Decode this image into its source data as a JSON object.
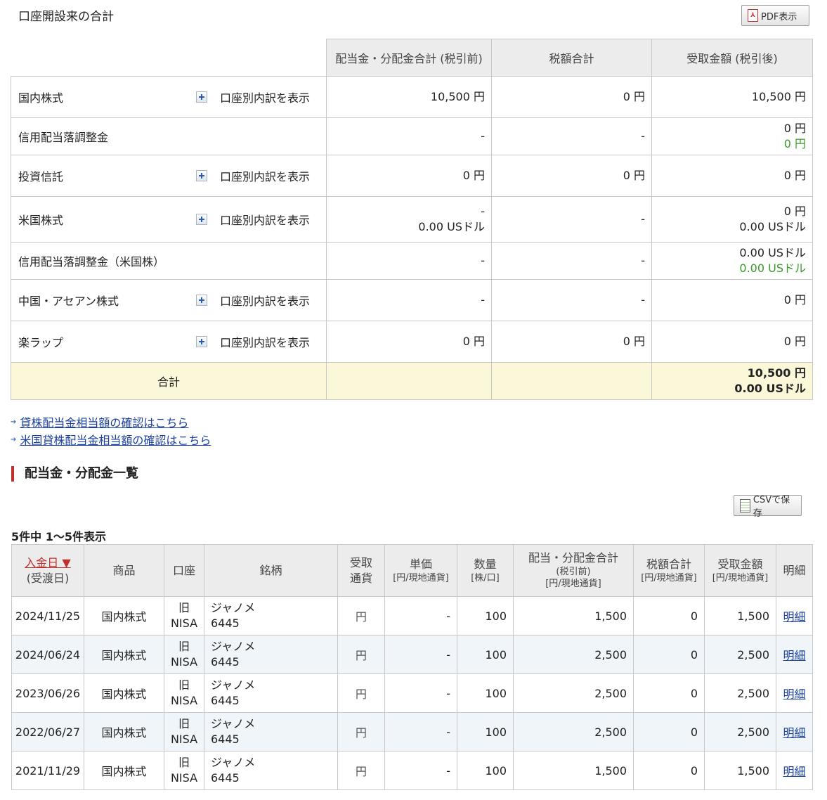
{
  "summary": {
    "title": "口座開設来の合計",
    "pdf_label": "PDF表示",
    "headers": [
      "配当金・分配金合計 (税引前)",
      "税額合計",
      "受取金額 (税引後)"
    ],
    "expand_label": "口座別内訳を表示",
    "rows": [
      {
        "label": "国内株式",
        "expandable": true,
        "pretax": [
          "10,500 円"
        ],
        "tax": [
          "0 円"
        ],
        "received": [
          "10,500 円"
        ],
        "received_green": []
      },
      {
        "label": "信用配当落調整金",
        "expandable": false,
        "pretax": [
          "-"
        ],
        "tax": [
          "-"
        ],
        "received": [
          "0 円"
        ],
        "received_green": [
          "0 円"
        ]
      },
      {
        "label": "投資信託",
        "expandable": true,
        "pretax": [
          "0 円"
        ],
        "tax": [
          "0 円"
        ],
        "received": [
          "0 円"
        ],
        "received_green": []
      },
      {
        "label": "米国株式",
        "expandable": true,
        "pretax": [
          "-",
          "0.00 USドル"
        ],
        "tax": [
          "-"
        ],
        "received": [
          "0 円",
          "0.00 USドル"
        ],
        "received_green": []
      },
      {
        "label": "信用配当落調整金（米国株）",
        "expandable": false,
        "pretax": [
          "-"
        ],
        "tax": [
          "-"
        ],
        "received": [
          "0.00 USドル"
        ],
        "received_green": [
          "0.00 USドル"
        ]
      },
      {
        "label": "中国・アセアン株式",
        "expandable": true,
        "pretax": [
          "-"
        ],
        "tax": [
          "-"
        ],
        "received": [
          "0 円"
        ],
        "received_green": []
      },
      {
        "label": "楽ラップ",
        "expandable": true,
        "pretax": [
          "0 円"
        ],
        "tax": [
          "0 円"
        ],
        "received": [
          "0 円"
        ],
        "received_green": []
      }
    ],
    "total": {
      "label": "合計",
      "received": [
        "10,500 円",
        "0.00 USドル"
      ]
    }
  },
  "links": {
    "lending": "貸株配当金相当額の確認はこちら",
    "us_lending": "米国貸株配当金相当額の確認はこちら"
  },
  "list": {
    "heading": "配当金・分配金一覧",
    "csv_label": "CSVで保存",
    "count_text": "5件中 1〜5件表示",
    "headers": {
      "date": "入金日 ▼",
      "date_sub": "(受渡日)",
      "product": "商品",
      "account": "口座",
      "issue": "銘柄",
      "currency_1": "受取",
      "currency_2": "通貨",
      "unit_price": "単価",
      "unit_price_sub": "[円/現地通貨]",
      "quantity": "数量",
      "quantity_sub": "[株/口]",
      "dividend": "配当・分配金合計",
      "dividend_sub1": "(税引前)",
      "dividend_sub2": "[円/現地通貨]",
      "tax": "税額合計",
      "tax_sub": "[円/現地通貨]",
      "received": "受取金額",
      "received_sub": "[円/現地通貨]",
      "detail": "明細"
    },
    "rows": [
      {
        "date": "2024/11/25",
        "product": "国内株式",
        "account_1": "旧",
        "account_2": "NISA",
        "issue_name": "ジャノメ",
        "issue_code": "6445",
        "currency": "円",
        "unit_price": "-",
        "quantity": "100",
        "dividend": "1,500",
        "tax": "0",
        "received": "1,500",
        "detail": "明細"
      },
      {
        "date": "2024/06/24",
        "product": "国内株式",
        "account_1": "旧",
        "account_2": "NISA",
        "issue_name": "ジャノメ",
        "issue_code": "6445",
        "currency": "円",
        "unit_price": "-",
        "quantity": "100",
        "dividend": "2,500",
        "tax": "0",
        "received": "2,500",
        "detail": "明細"
      },
      {
        "date": "2023/06/26",
        "product": "国内株式",
        "account_1": "旧",
        "account_2": "NISA",
        "issue_name": "ジャノメ",
        "issue_code": "6445",
        "currency": "円",
        "unit_price": "-",
        "quantity": "100",
        "dividend": "2,500",
        "tax": "0",
        "received": "2,500",
        "detail": "明細"
      },
      {
        "date": "2022/06/27",
        "product": "国内株式",
        "account_1": "旧",
        "account_2": "NISA",
        "issue_name": "ジャノメ",
        "issue_code": "6445",
        "currency": "円",
        "unit_price": "-",
        "quantity": "100",
        "dividend": "2,500",
        "tax": "0",
        "received": "2,500",
        "detail": "明細"
      },
      {
        "date": "2021/11/29",
        "product": "国内株式",
        "account_1": "旧",
        "account_2": "NISA",
        "issue_name": "ジャノメ",
        "issue_code": "6445",
        "currency": "円",
        "unit_price": "-",
        "quantity": "100",
        "dividend": "1,500",
        "tax": "0",
        "received": "1,500",
        "detail": "明細"
      }
    ]
  }
}
